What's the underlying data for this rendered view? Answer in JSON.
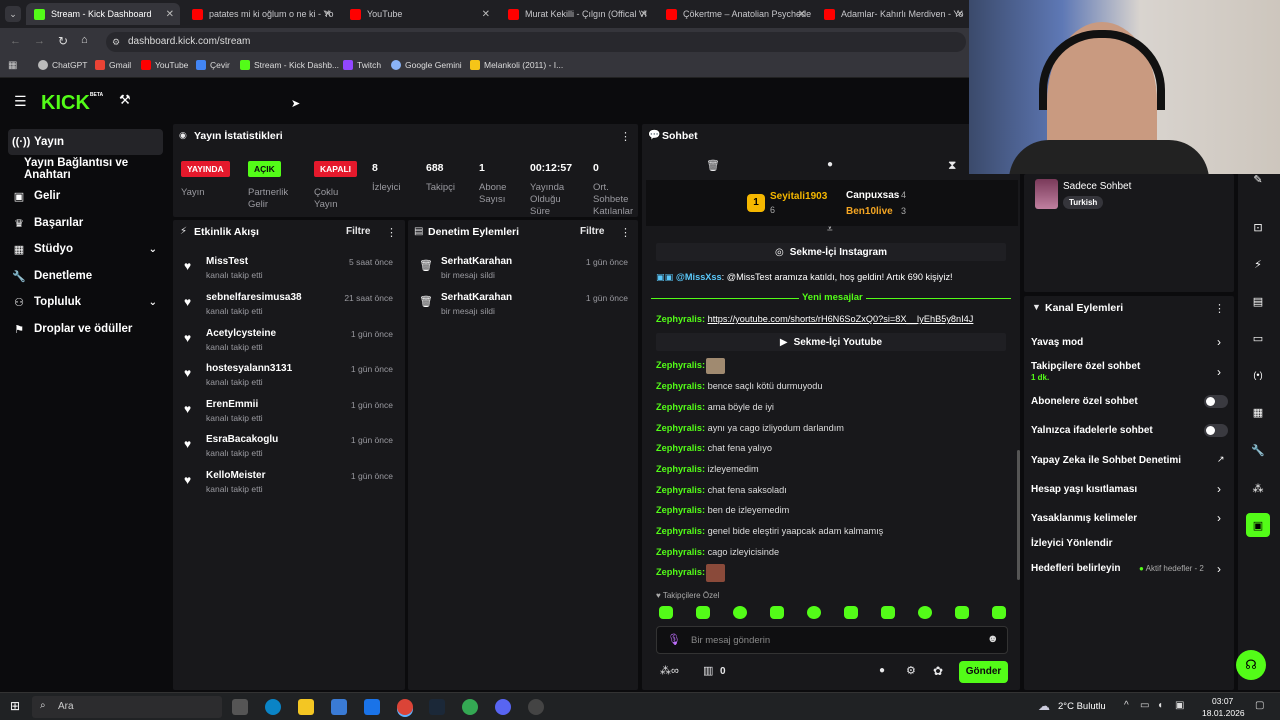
{
  "browser": {
    "tabs": [
      {
        "label": "Stream - Kick Dashboard",
        "color": "#53fc18"
      },
      {
        "label": "patates mi ki oğlum o ne ki - Yo",
        "color": "#ff0000"
      },
      {
        "label": "YouTube",
        "color": "#ff0000"
      },
      {
        "label": "Murat Kekilli - Çılgın (Offical Vi",
        "color": "#ff0000"
      },
      {
        "label": "Çökertme – Anatolian Psychede",
        "color": "#ff0000"
      },
      {
        "label": "Adamlar- Kahırlı Merdiven - Yo",
        "color": "#ff0000"
      }
    ],
    "url": "dashboard.kick.com/stream",
    "bookmarks": [
      "ChatGPT",
      "Gmail",
      "YouTube",
      "Çevir",
      "Stream - Kick Dashb...",
      "Twitch",
      "Google Gemini",
      "Melankoli (2011) - I..."
    ]
  },
  "brand": {
    "logo": "KICK",
    "beta": "BETA",
    "accent": "#53fc18"
  },
  "sidebar": {
    "items": [
      {
        "label": "Yayın",
        "icon": "broadcast-icon"
      },
      {
        "label": "Yayın Bağlantısı ve Anahtarı",
        "icon": ""
      },
      {
        "label": "Gelir",
        "icon": "wallet-icon"
      },
      {
        "label": "Başarılar",
        "icon": "trophy-icon"
      },
      {
        "label": "Stüdyo",
        "icon": "grid-icon"
      },
      {
        "label": "Denetleme",
        "icon": "wrench-icon"
      },
      {
        "label": "Topluluk",
        "icon": "people-icon"
      },
      {
        "label": "Droplar ve ödüller",
        "icon": "gift-icon"
      }
    ]
  },
  "stats": {
    "title": "Yayın İstatistikleri",
    "badges": [
      {
        "value": "YAYINDA",
        "label": "Yayın",
        "bg": "#e5192c",
        "fg": "#ffffff"
      },
      {
        "value": "AÇIK",
        "label": "Partnerlik Gelir",
        "bg": "#53fc18",
        "fg": "#0b0b0d"
      },
      {
        "value": "KAPALI",
        "label": "Çoklu Yayın",
        "bg": "#e5192c",
        "fg": "#ffffff"
      }
    ],
    "numbers": [
      {
        "value": "8",
        "label": "İzleyici"
      },
      {
        "value": "688",
        "label": "Takipçi"
      },
      {
        "value": "1",
        "label": "Abone Sayısı"
      },
      {
        "value": "00:12:57",
        "label": "Yayında Olduğu Süre"
      },
      {
        "value": "0",
        "label": "Ort. Sohbete Katılanlar"
      }
    ]
  },
  "activity": {
    "title": "Etkinlik Akışı",
    "filter": "Filtre",
    "rows": [
      {
        "name": "MissTest",
        "sub": "kanalı takip etti",
        "time": "5 saat önce"
      },
      {
        "name": "sebnelfaresimusa38",
        "sub": "kanalı takip etti",
        "time": "21 saat önce"
      },
      {
        "name": "Acetylcysteine",
        "sub": "kanalı takip etti",
        "time": "1 gün önce"
      },
      {
        "name": "hostesyalann3131",
        "sub": "kanalı takip etti",
        "time": "1 gün önce"
      },
      {
        "name": "ErenEmmii",
        "sub": "kanalı takip etti",
        "time": "1 gün önce"
      },
      {
        "name": "EsraBacakoglu",
        "sub": "kanalı takip etti",
        "time": "1 gün önce"
      },
      {
        "name": "KelloMeister",
        "sub": "kanalı takip etti",
        "time": "1 gün önce"
      }
    ]
  },
  "moderation": {
    "title": "Denetim Eylemleri",
    "filter": "Filtre",
    "rows": [
      {
        "name": "SerhatKarahan",
        "sub": "bir mesajı sildi",
        "time": "1 gün önce"
      },
      {
        "name": "SerhatKarahan",
        "sub": "bir mesajı sildi",
        "time": "1 gün önce"
      }
    ]
  },
  "chat": {
    "title": "Sohbet",
    "leaders": [
      {
        "rank": "1",
        "name": "Seyitali1903",
        "count": "6"
      },
      {
        "name": "Canpuxsas",
        "count": "4"
      },
      {
        "name": "Ben10live",
        "count": "3"
      }
    ],
    "instagram": "Sekme-İçi Instagram",
    "youtube": "Sekme-İçi Youtube",
    "join_user": "@MissXss",
    "join_text": ": @MissTest aramıza katıldı, hoş geldin! Artık 690 kişiyiz!",
    "new_messages": "Yeni mesajlar",
    "link_user": "Zephyralis:",
    "link": "https://youtube.com/shorts/rH6N6SoZxQ0?si=8X__IyEhB5y8nI4J",
    "messages": [
      {
        "user": "Zephyralis:",
        "text": ""
      },
      {
        "user": "Zephyralis:",
        "text": "bence saçlı kötü durmuyodu"
      },
      {
        "user": "Zephyralis:",
        "text": "ama böyle de iyi"
      },
      {
        "user": "Zephyralis:",
        "text": "aynı ya cago izliyodum darlandım"
      },
      {
        "user": "Zephyralis:",
        "text": "chat fena yalıyo"
      },
      {
        "user": "Zephyralis:",
        "text": "izleyemedim"
      },
      {
        "user": "Zephyralis:",
        "text": "chat fena saksoladı"
      },
      {
        "user": "Zephyralis:",
        "text": "ben de izleyemedim"
      },
      {
        "user": "Zephyralis:",
        "text": "genel bide eleştiri yaapcak adam kalmamış"
      },
      {
        "user": "Zephyralis:",
        "text": "cago izleyicisinde"
      },
      {
        "user": "Zephyralis:",
        "text": ""
      }
    ],
    "followers_only": "Takipçilere Özel",
    "placeholder": "Bir mesaj gönderin",
    "points": "0",
    "send": "Gönder"
  },
  "side_chat": {
    "name": "Sadece Sohbet",
    "tag": "Turkish"
  },
  "channel_actions": {
    "title": "Kanal Eylemleri",
    "items": [
      {
        "label": "Yavaş mod",
        "sub": "",
        "control": "arrow"
      },
      {
        "label": "Takipçilere özel sohbet",
        "sub": "1 dk.",
        "control": "arrow"
      },
      {
        "label": "Abonelere özel sohbet",
        "sub": "",
        "control": "toggle"
      },
      {
        "label": "Yalnızca ifadelerle sohbet",
        "sub": "",
        "control": "toggle"
      },
      {
        "label": "Yapay Zeka ile Sohbet Denetimi",
        "sub": "",
        "control": "external"
      },
      {
        "label": "Hesap yaşı kısıtlaması",
        "sub": "",
        "control": "arrow"
      },
      {
        "label": "Yasaklanmış kelimeler",
        "sub": "",
        "control": "arrow"
      },
      {
        "label": "İzleyici Yönlendir",
        "sub": "",
        "control": "none"
      },
      {
        "label": "Hedefleri belirleyin",
        "sub": "",
        "control": "arrow"
      }
    ],
    "goal_status": "Aktif hedefler - 2"
  },
  "taskbar": {
    "search": "Ara",
    "weather": "2°C  Bulutlu",
    "time": "03:07",
    "date": "18.01.2026"
  }
}
